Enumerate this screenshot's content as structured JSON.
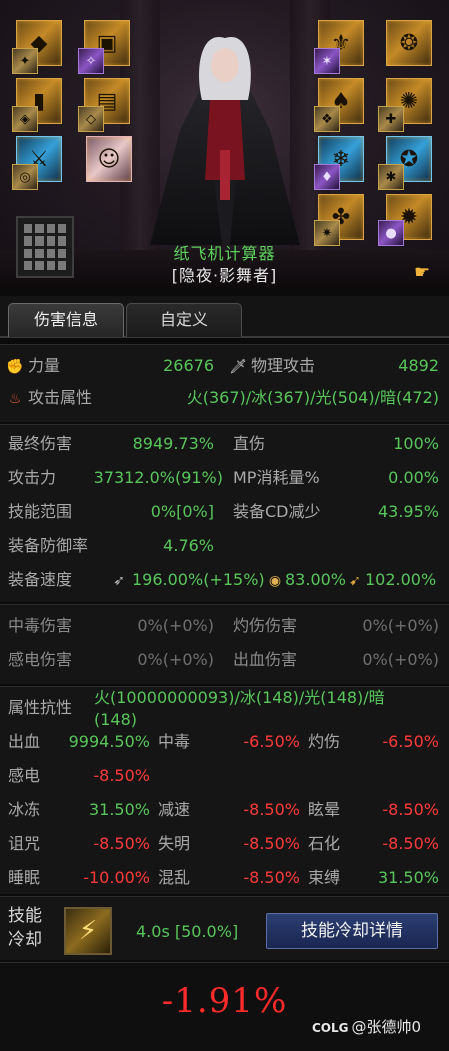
{
  "character": {
    "name": "纸飞机计算器",
    "title": "[隐夜·影舞者]",
    "equipment_icons": [
      "shoulder-armor-icon",
      "belt-icon",
      "chest-armor-icon",
      "pants-icon",
      "weapon-icon",
      "avatar-icon",
      "ring-icon",
      "necklace-icon",
      "claw-icon",
      "bracelet-icon",
      "orb-icon",
      "earring-icon",
      "gem-icon",
      "shoe-icon"
    ]
  },
  "tabs": [
    "伤害信息",
    "自定义"
  ],
  "basic": {
    "strength_label": "力量",
    "strength_value": "26676",
    "phys_atk_label": "物理攻击",
    "phys_atk_value": "4892",
    "element_label": "攻击属性",
    "element_value": "火(367)/冰(367)/光(504)/暗(472)"
  },
  "damage": {
    "final_label": "最终伤害",
    "final_value": "8949.73%",
    "direct_label": "直伤",
    "direct_value": "100%",
    "attack_label": "攻击力",
    "attack_value": "37312.0%(91%)",
    "mp_label": "MP消耗量%",
    "mp_value": "0.00%",
    "range_label": "技能范围",
    "range_value": "0%[0%]",
    "cd_label": "装备CD减少",
    "cd_value": "43.95%",
    "def_label": "装备防御率",
    "def_value": "4.76%",
    "speed_label": "装备速度",
    "speed_atk": "196.00%(+15%)",
    "speed_cast": "83.00%",
    "speed_move": "102.00%"
  },
  "dot": {
    "poison_label": "中毒伤害",
    "poison_value": "0%(+0%)",
    "burn_label": "灼伤伤害",
    "burn_value": "0%(+0%)",
    "shock_label": "感电伤害",
    "shock_value": "0%(+0%)",
    "bleed_label": "出血伤害",
    "bleed_value": "0%(+0%)"
  },
  "resist": {
    "label": "属性抗性",
    "value_line1": "火(10000000093)/冰(148)/光(148)/暗",
    "value_line2": "(148)",
    "items": [
      {
        "label": "出血",
        "value": "9994.50%",
        "color": "#58c65a"
      },
      {
        "label": "中毒",
        "value": "-6.50%",
        "color": "#ff3a3a"
      },
      {
        "label": "灼伤",
        "value": "-6.50%",
        "color": "#ff3a3a"
      },
      {
        "label": "感电",
        "value": "-8.50%",
        "color": "#ff3a3a"
      },
      {
        "label": "冰冻",
        "value": "31.50%",
        "color": "#58c65a"
      },
      {
        "label": "减速",
        "value": "-8.50%",
        "color": "#ff3a3a"
      },
      {
        "label": "眩晕",
        "value": "-8.50%",
        "color": "#ff3a3a"
      },
      {
        "label": "诅咒",
        "value": "-8.50%",
        "color": "#ff3a3a"
      },
      {
        "label": "失明",
        "value": "-8.50%",
        "color": "#ff3a3a"
      },
      {
        "label": "石化",
        "value": "-8.50%",
        "color": "#ff3a3a"
      },
      {
        "label": "睡眠",
        "value": "-10.00%",
        "color": "#ff3a3a"
      },
      {
        "label": "混乱",
        "value": "-8.50%",
        "color": "#ff3a3a"
      },
      {
        "label": "束缚",
        "value": "31.50%",
        "color": "#58c65a"
      }
    ]
  },
  "skill_cd": {
    "label_line1": "技能",
    "label_line2": "冷却",
    "value": "4.0s [50.0%]",
    "button": "技能冷却详情"
  },
  "result": {
    "value": "-1.91%"
  },
  "credit": {
    "logo": "COLG",
    "text": "@张德帅0"
  }
}
